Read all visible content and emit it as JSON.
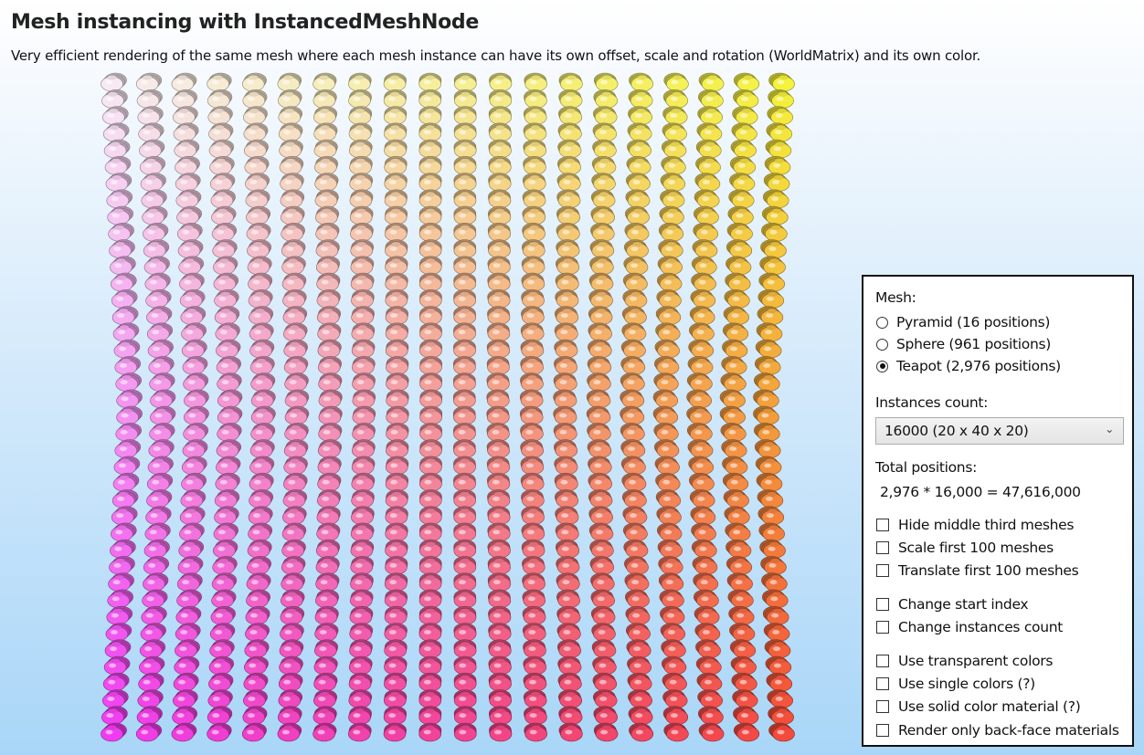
{
  "header": {
    "title": "Mesh instancing with InstancedMeshNode",
    "subtitle": "Very efficient rendering of the same mesh where each mesh instance can have its own offset, scale and rotation (WorldMatrix) and its own color."
  },
  "viewport": {
    "scene": "teapot instance grid",
    "colors": {
      "top_left": "#f7eaf2",
      "top_right": "#f4f23c",
      "bottom_left": "#f03cf0",
      "bottom_right": "#f34b3b"
    }
  },
  "panel": {
    "mesh_label": "Mesh:",
    "mesh_options": [
      {
        "label": "Pyramid (16 positions)",
        "selected": false
      },
      {
        "label": "Sphere (961 positions)",
        "selected": false
      },
      {
        "label": "Teapot (2,976 positions)",
        "selected": true
      }
    ],
    "instances_label": "Instances count:",
    "instances_value": "16000 (20 x 40 x 20)",
    "total_label": "Total positions:",
    "total_value": "2,976 * 16,000 = 47,616,000",
    "checkboxes": [
      {
        "label": "Hide middle third meshes",
        "checked": false
      },
      {
        "label": "Scale first 100 meshes",
        "checked": false
      },
      {
        "label": "Translate first 100 meshes",
        "checked": false
      },
      {
        "label": "Change start index",
        "checked": false
      },
      {
        "label": "Change instances count",
        "checked": false
      },
      {
        "label": "Use transparent colors",
        "checked": false
      },
      {
        "label": "Use single colors (?)",
        "checked": false
      },
      {
        "label": "Use solid color material (?)",
        "checked": false
      },
      {
        "label": "Render only back-face materials",
        "checked": false
      }
    ]
  }
}
